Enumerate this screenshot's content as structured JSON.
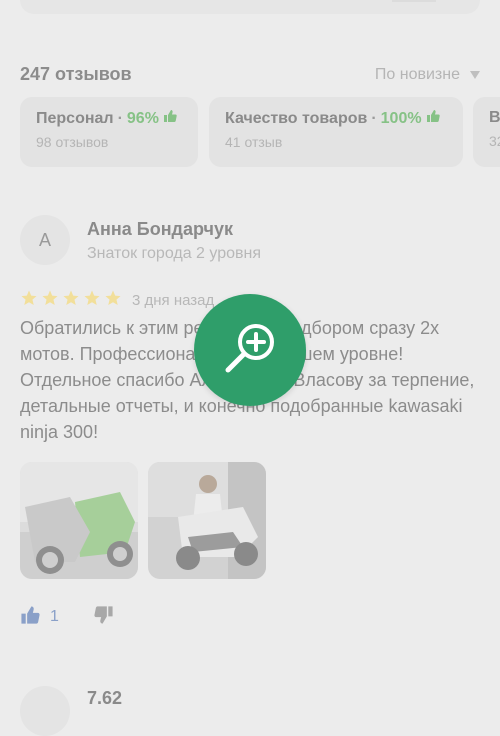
{
  "header": {
    "review_count": "247 отзывов",
    "sort_label": "По новизне"
  },
  "categories": [
    {
      "name": "Персонал",
      "percent": "96%",
      "count": "98 отзывов"
    },
    {
      "name": "Качество товаров",
      "percent": "100%",
      "count": "41 отзыв"
    },
    {
      "name": "В",
      "percent": "",
      "count": "32"
    }
  ],
  "review": {
    "avatar_letter": "А",
    "author": "Анна Бондарчук",
    "level": "Знаток города 2 уровня",
    "stars": 5,
    "date": "3 дня назад",
    "text": "Обратились к этим ребятам за подбором сразу 2х мотов. Профессионализм на высшем уровне! Отдельное спасибо Александру Власову за терпение, детальные отчеты, и конечно подобранные kawasaki ninja 300!",
    "likes": "1",
    "photo_count": 2
  },
  "next_review": {
    "score": "7.62"
  },
  "colors": {
    "background": "#ececec",
    "accent_green": "#86c286",
    "zoom_button": "#2f9e6a",
    "like_blue": "#8aa0c8",
    "star_yellow": "#f2df9a"
  },
  "icons": [
    "thumb-up-icon",
    "star-icon",
    "zoom-in-icon",
    "thumb-down-icon",
    "chevron-down-icon"
  ]
}
